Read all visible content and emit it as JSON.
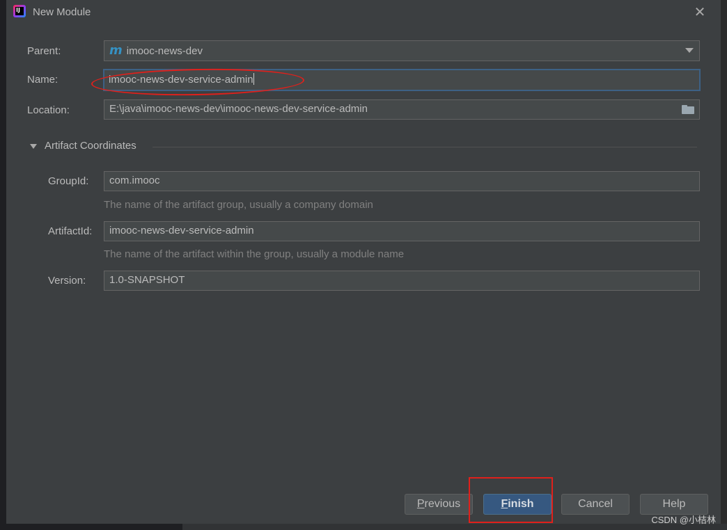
{
  "window": {
    "title": "New Module",
    "app_icon_text": "IJ"
  },
  "form": {
    "parent_label": "Parent:",
    "parent_value": "imooc-news-dev",
    "parent_icon_glyph": "m",
    "name_label": "Name:",
    "name_value": "imooc-news-dev-service-admin",
    "location_label": "Location:",
    "location_value": "E:\\java\\imooc-news-dev\\imooc-news-dev-service-admin"
  },
  "artifact": {
    "section_title": "Artifact Coordinates",
    "groupid_label": "GroupId:",
    "groupid_value": "com.imooc",
    "groupid_hint": "The name of the artifact group, usually a company domain",
    "artifactid_label": "ArtifactId:",
    "artifactid_value": "imooc-news-dev-service-admin",
    "artifactid_hint": "The name of the artifact within the group, usually a module name",
    "version_label": "Version:",
    "version_value": "1.0-SNAPSHOT"
  },
  "buttons": {
    "previous_mnemonic": "P",
    "previous_rest": "revious",
    "finish_mnemonic": "F",
    "finish_rest": "inish",
    "cancel": "Cancel",
    "help": "Help"
  },
  "watermark": "CSDN @小桔林",
  "colors": {
    "annotation_red": "#e0201b",
    "accent_blue": "#365880",
    "dialog_bg": "#3c3f41"
  }
}
